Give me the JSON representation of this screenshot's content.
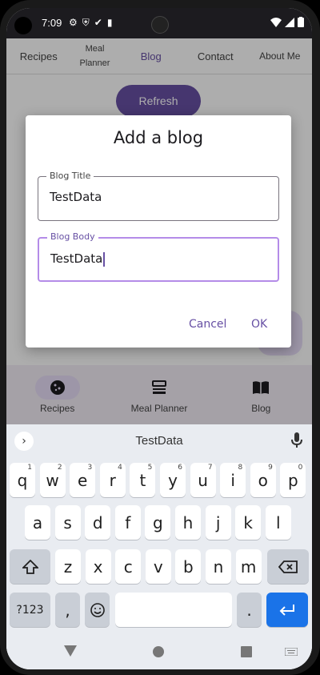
{
  "status_bar": {
    "time": "7:09"
  },
  "app": {
    "top_tabs": [
      "Recipes",
      "Meal Planner",
      "Blog",
      "Contact",
      "About Me"
    ],
    "active_tab": "Blog",
    "refresh_label": "Refresh",
    "bottom_nav": [
      {
        "label": "Recipes",
        "icon": "cookie-icon"
      },
      {
        "label": "Meal Planner",
        "icon": "meal-planner-icon"
      },
      {
        "label": "Blog",
        "icon": "book-icon"
      }
    ]
  },
  "dialog": {
    "title": "Add a blog",
    "fields": [
      {
        "label": "Blog Title",
        "value": "TestData"
      },
      {
        "label": "Blog Body",
        "value": "TestData"
      }
    ],
    "cancel_label": "Cancel",
    "ok_label": "OK"
  },
  "keyboard": {
    "suggestion": "TestData",
    "row1": [
      {
        "k": "q",
        "h": "1"
      },
      {
        "k": "w",
        "h": "2"
      },
      {
        "k": "e",
        "h": "3"
      },
      {
        "k": "r",
        "h": "4"
      },
      {
        "k": "t",
        "h": "5"
      },
      {
        "k": "y",
        "h": "6"
      },
      {
        "k": "u",
        "h": "7"
      },
      {
        "k": "i",
        "h": "8"
      },
      {
        "k": "o",
        "h": "9"
      },
      {
        "k": "p",
        "h": "0"
      }
    ],
    "row2": [
      "a",
      "s",
      "d",
      "f",
      "g",
      "h",
      "j",
      "k",
      "l"
    ],
    "row3": [
      "z",
      "x",
      "c",
      "v",
      "b",
      "n",
      "m"
    ],
    "symbols_label": "?123",
    "comma": ",",
    "period": "."
  },
  "colors": {
    "accent": "#6750a4",
    "enter": "#1a73e8"
  }
}
